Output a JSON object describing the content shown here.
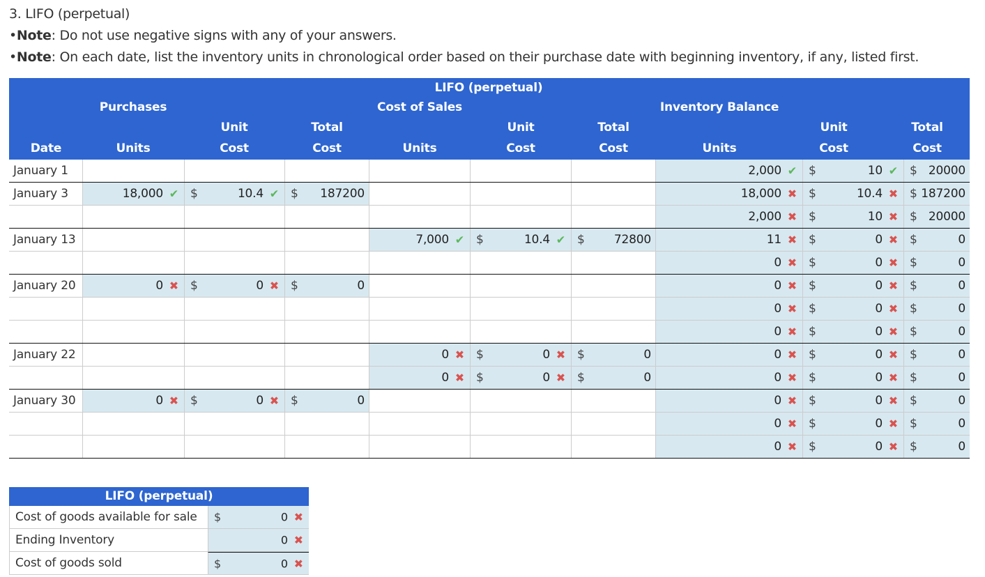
{
  "heading": "3. LIFO (perpetual)",
  "notes": [
    {
      "bullet": "•",
      "label": "Note",
      "text": ": Do not use negative signs with any of your answers."
    },
    {
      "bullet": "•",
      "label": "Note",
      "text": ": On each date, list the inventory units in chronological order based on their purchase date with beginning inventory, if any, listed first."
    }
  ],
  "table": {
    "title": "LIFO (perpetual)",
    "groups": {
      "purchases": "Purchases",
      "sales": "Cost of Sales",
      "inventory": "Inventory Balance"
    },
    "columns": {
      "date": "Date",
      "units": "Units",
      "unit_top": "Unit",
      "cost": "Cost",
      "total_top": "Total"
    },
    "currency": "$",
    "rows": [
      {
        "date": "January 1",
        "group_end": true,
        "p": null,
        "s": null,
        "i": {
          "units": "2,000",
          "units_mark": "ok",
          "unit_cost": "10",
          "unit_cost_mark": "ok",
          "total": "20000"
        }
      },
      {
        "date": "January 3",
        "group_end": false,
        "p": {
          "units": "18,000",
          "units_mark": "ok",
          "unit_cost": "10.4",
          "unit_cost_mark": "ok",
          "total": "187200"
        },
        "s": null,
        "i": {
          "units": "18,000",
          "units_mark": "bad",
          "unit_cost": "10.4",
          "unit_cost_mark": "bad",
          "total": "187200"
        }
      },
      {
        "date": "",
        "group_end": true,
        "p": null,
        "s": null,
        "i": {
          "units": "2,000",
          "units_mark": "bad",
          "unit_cost": "10",
          "unit_cost_mark": "bad",
          "total": "20000"
        }
      },
      {
        "date": "January 13",
        "group_end": false,
        "p": null,
        "s": {
          "units": "7,000",
          "units_mark": "ok",
          "unit_cost": "10.4",
          "unit_cost_mark": "ok",
          "total": "72800"
        },
        "i": {
          "units": "11",
          "units_mark": "bad",
          "unit_cost": "0",
          "unit_cost_mark": "bad",
          "total": "0"
        }
      },
      {
        "date": "",
        "group_end": true,
        "p": null,
        "s": null,
        "i": {
          "units": "0",
          "units_mark": "bad",
          "unit_cost": "0",
          "unit_cost_mark": "bad",
          "total": "0"
        }
      },
      {
        "date": "January 20",
        "group_end": false,
        "p": {
          "units": "0",
          "units_mark": "bad",
          "unit_cost": "0",
          "unit_cost_mark": "bad",
          "total": "0"
        },
        "s": null,
        "i": {
          "units": "0",
          "units_mark": "bad",
          "unit_cost": "0",
          "unit_cost_mark": "bad",
          "total": "0"
        }
      },
      {
        "date": "",
        "group_end": false,
        "p": null,
        "s": null,
        "i": {
          "units": "0",
          "units_mark": "bad",
          "unit_cost": "0",
          "unit_cost_mark": "bad",
          "total": "0"
        }
      },
      {
        "date": "",
        "group_end": true,
        "p": null,
        "s": null,
        "i": {
          "units": "0",
          "units_mark": "bad",
          "unit_cost": "0",
          "unit_cost_mark": "bad",
          "total": "0"
        }
      },
      {
        "date": "January 22",
        "group_end": false,
        "p": null,
        "s": {
          "units": "0",
          "units_mark": "bad",
          "unit_cost": "0",
          "unit_cost_mark": "bad",
          "total": "0"
        },
        "i": {
          "units": "0",
          "units_mark": "bad",
          "unit_cost": "0",
          "unit_cost_mark": "bad",
          "total": "0"
        }
      },
      {
        "date": "",
        "group_end": true,
        "p": null,
        "s": {
          "units": "0",
          "units_mark": "bad",
          "unit_cost": "0",
          "unit_cost_mark": "bad",
          "total": "0"
        },
        "i": {
          "units": "0",
          "units_mark": "bad",
          "unit_cost": "0",
          "unit_cost_mark": "bad",
          "total": "0"
        }
      },
      {
        "date": "January 30",
        "group_end": false,
        "p": {
          "units": "0",
          "units_mark": "bad",
          "unit_cost": "0",
          "unit_cost_mark": "bad",
          "total": "0"
        },
        "s": null,
        "i": {
          "units": "0",
          "units_mark": "bad",
          "unit_cost": "0",
          "unit_cost_mark": "bad",
          "total": "0"
        }
      },
      {
        "date": "",
        "group_end": false,
        "p": null,
        "s": null,
        "i": {
          "units": "0",
          "units_mark": "bad",
          "unit_cost": "0",
          "unit_cost_mark": "bad",
          "total": "0"
        }
      },
      {
        "date": "",
        "group_end": true,
        "p": null,
        "s": null,
        "i": {
          "units": "0",
          "units_mark": "bad",
          "unit_cost": "0",
          "unit_cost_mark": "bad",
          "total": "0"
        }
      }
    ]
  },
  "summary": {
    "title": "LIFO (perpetual)",
    "rows": [
      {
        "label": "Cost of goods available for sale",
        "currency": "$",
        "value": "0",
        "mark": "bad"
      },
      {
        "label": "Ending Inventory",
        "currency": "",
        "value": "0",
        "mark": "bad"
      },
      {
        "label": "Cost of goods sold",
        "currency": "$",
        "value": "0",
        "mark": "bad"
      }
    ]
  },
  "icons": {
    "ok": "✔",
    "bad": "✖"
  },
  "colors": {
    "header_bg": "#2e65d0",
    "input_bg": "#d7e8f0",
    "correct": "#5cb85c",
    "incorrect": "#d9534f"
  }
}
